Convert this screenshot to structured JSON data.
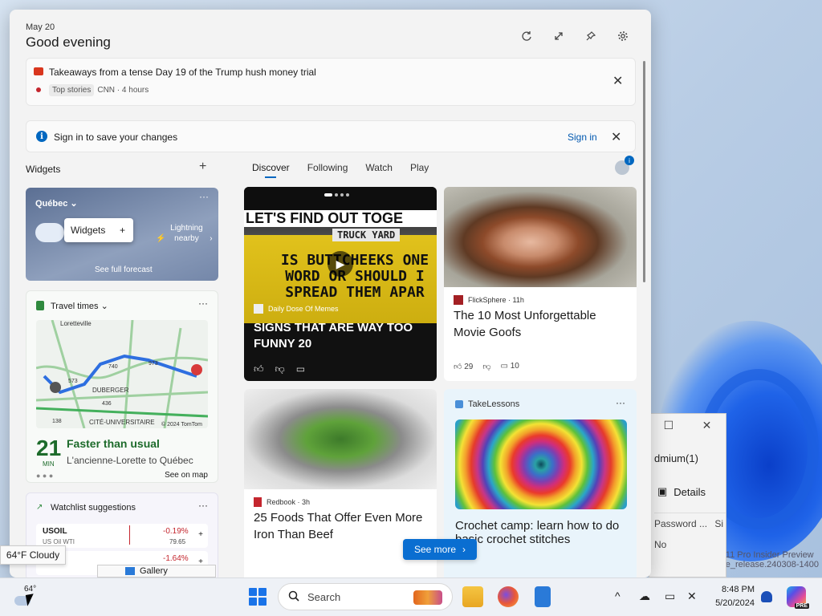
{
  "header": {
    "date": "May 20",
    "greeting": "Good evening"
  },
  "banner": {
    "headline": "Takeaways from a tense Day 19 of the Trump hush money trial",
    "tag": "Top stories",
    "source": "CNN · 4 hours"
  },
  "signin": {
    "message": "Sign in to save your changes",
    "button": "Sign in"
  },
  "widgets_label": "Widgets",
  "tabs": [
    {
      "label": "Discover",
      "active": true
    },
    {
      "label": "Following",
      "active": false
    },
    {
      "label": "Watch",
      "active": false
    },
    {
      "label": "Play",
      "active": false
    }
  ],
  "weather_widget": {
    "city": "Québec",
    "tooltip": "Widgets",
    "alert": "Lightning nearby",
    "forecast_link": "See full forecast"
  },
  "travel_widget": {
    "title": "Travel times",
    "minutes": "21",
    "min_label": "MIN",
    "status": "Faster than usual",
    "route": "L'ancienne-Lorette to Québec",
    "map_link": "See on map",
    "map_labels": [
      "Loretteville",
      "573",
      "973",
      "740",
      "DUBERGER",
      "436",
      "138",
      "CITÉ-UNIVERSITAIRE",
      "© 2024 TomTom"
    ]
  },
  "watchlist_widget": {
    "title": "Watchlist suggestions",
    "stocks": [
      {
        "symbol": "USOIL",
        "name": "US Oil WTI",
        "change": "-0.19%",
        "price": "79.65"
      },
      {
        "symbol": "",
        "name": "",
        "change": "-1.64%",
        "price": ""
      }
    ]
  },
  "feed": {
    "card1": {
      "source": "Daily Dose Of Memes",
      "title": "SIGNS THAT ARE WAY TOO FUNNY 20",
      "image_text_top": "LET'S FIND OUT TOGE",
      "image_sign_small": "TRUCK YARD",
      "image_sign": "IS BUTTCHEEKS ONE WORD OR SHOULD I SPREAD THEM APAR"
    },
    "card2": {
      "source": "FlickSphere · 11h",
      "title": "The 10 Most Unforgettable Movie Goofs",
      "likes": "29",
      "comments": "10"
    },
    "card3": {
      "source": "Redbook · 3h",
      "title": "25 Foods That Offer Even More Iron Than Beef"
    },
    "card4": {
      "source": "TakeLessons",
      "title": "Crochet camp: learn how to do basic crochet stitches"
    }
  },
  "see_more": "See more",
  "tooltip": "64°F Cloudy",
  "gallery": "Gallery",
  "background_window": {
    "text1": "dmium(1)",
    "details": "Details",
    "col1": "Password ...",
    "col2": "Si",
    "row": "No"
  },
  "insider": {
    "line1": "11 Pro Insider Preview",
    "line2": "e_release.240308-1400"
  },
  "taskbar": {
    "temp": "64°",
    "search_placeholder": "Search",
    "time": "8:48 PM",
    "date": "5/20/2024",
    "copilot_badge": "PRE"
  },
  "colors": {
    "accent": "#0067c0",
    "green": "#1d6b2b",
    "negative": "#c4262e"
  }
}
